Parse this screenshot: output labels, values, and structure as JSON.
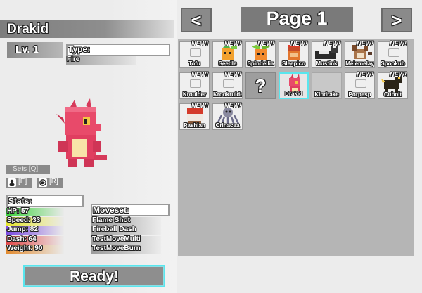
{
  "creature": {
    "name": "Drakid",
    "level": "Lv. 1",
    "type_label": "Type:",
    "type_value": "Fire"
  },
  "controls": {
    "sets": "Sets [Q]",
    "key_e": "[E]",
    "key_r": "[R]",
    "ready": "Ready!"
  },
  "stats": {
    "header": "Stats:",
    "items": [
      {
        "label": "HP: 57",
        "color": "#3bd23b"
      },
      {
        "label": "Speed: 33",
        "color": "#e6e62e"
      },
      {
        "label": "Jump: 82",
        "color": "#7a4ae0"
      },
      {
        "label": "Dash: 64",
        "color": "#e24848"
      },
      {
        "label": "Weight: 90",
        "color": "#e28a2e"
      }
    ]
  },
  "moveset": {
    "header": "Moveset:",
    "items": [
      "Flame Shot",
      "Fireball Dash",
      "TestMoveMulti",
      "TestMoveBurn"
    ]
  },
  "pager": {
    "prev": "<",
    "next": ">",
    "title": "Page 1"
  },
  "grid": {
    "new_badge": "NEW!",
    "unknown": "?",
    "cells": [
      {
        "label": "Tofu",
        "new": true,
        "kind": "placeholder"
      },
      {
        "label": "Seedle",
        "new": true,
        "kind": "sprite",
        "icon": "seedle-icon"
      },
      {
        "label": "Spindellia",
        "new": true,
        "kind": "sprite",
        "icon": "spindellia-icon"
      },
      {
        "label": "Sleepico",
        "new": true,
        "kind": "sprite",
        "icon": "sleepico-icon"
      },
      {
        "label": "Mustink",
        "new": true,
        "kind": "sprite",
        "icon": "mustink-icon"
      },
      {
        "label": "Meiemelay",
        "new": true,
        "kind": "sprite",
        "icon": "meiemelay-icon"
      },
      {
        "label": "Spookub",
        "new": true,
        "kind": "placeholder"
      },
      {
        "label": "Kroulder",
        "new": true,
        "kind": "placeholder"
      },
      {
        "label": "Krookruider",
        "new": true,
        "kind": "placeholder"
      },
      {
        "label": "",
        "new": false,
        "kind": "unknown"
      },
      {
        "label": "Drakid",
        "new": false,
        "kind": "sprite",
        "icon": "drakid-icon",
        "selected": true
      },
      {
        "label": "Kindrake",
        "new": false,
        "kind": "blank"
      },
      {
        "label": "Porpesp",
        "new": true,
        "kind": "placeholder"
      },
      {
        "label": "Cubolt",
        "new": true,
        "kind": "sprite",
        "icon": "cubolt-icon"
      },
      {
        "label": "Pashlan",
        "new": true,
        "kind": "sprite",
        "icon": "pashlan-icon"
      },
      {
        "label": "Crinacea",
        "new": true,
        "kind": "sprite",
        "icon": "crinacea-icon"
      }
    ]
  }
}
